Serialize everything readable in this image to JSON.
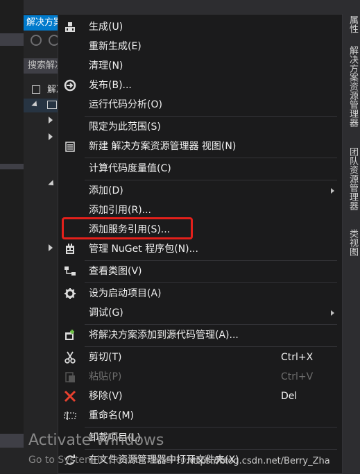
{
  "solution_explorer": {
    "title": "解决方案资源管理器",
    "search_placeholder": "搜索解决方案资源管理器",
    "root_label": "解决方案"
  },
  "right_tabs": [
    {
      "label": "属性"
    },
    {
      "label": "解决方案资源管理器"
    },
    {
      "label": "团队资源管理器"
    },
    {
      "label": "类视图"
    }
  ],
  "menu": {
    "items": [
      {
        "label": "生成(U)",
        "icon": "build-icon"
      },
      {
        "label": "重新生成(E)"
      },
      {
        "label": "清理(N)"
      },
      {
        "label": "发布(B)...",
        "icon": "publish-icon"
      },
      {
        "label": "运行代码分析(O)"
      },
      {
        "label": "限定为此范围(S)"
      },
      {
        "label": "新建 解决方案资源管理器 视图(N)",
        "icon": "new-view-icon"
      },
      {
        "label": "计算代码度量值(C)"
      },
      {
        "label": "添加(D)",
        "submenu": true
      },
      {
        "label": "添加引用(R)..."
      },
      {
        "label": "添加服务引用(S)..."
      },
      {
        "label": "管理 NuGet 程序包(N)...",
        "icon": "nuget-icon"
      },
      {
        "label": "查看类图(V)",
        "icon": "class-diagram-icon"
      },
      {
        "label": "设为启动项目(A)",
        "icon": "gear-icon"
      },
      {
        "label": "调试(G)",
        "submenu": true
      },
      {
        "label": "将解决方案添加到源代码管理(A)...",
        "icon": "source-control-icon"
      },
      {
        "label": "剪切(T)",
        "shortcut": "Ctrl+X",
        "icon": "scissors-icon"
      },
      {
        "label": "粘贴(P)",
        "shortcut": "Ctrl+V",
        "icon": "paste-icon",
        "disabled": true
      },
      {
        "label": "移除(V)",
        "shortcut": "Del",
        "icon": "remove-x-icon"
      },
      {
        "label": "重命名(M)",
        "icon": "rename-icon"
      },
      {
        "label": "卸载项目(L)"
      },
      {
        "label": "在文件资源管理器中打开文件夹(X)",
        "icon": "refresh-folder-icon"
      }
    ]
  },
  "watermark": {
    "line1": "Activate Windows",
    "line2": "Go to System in Control Panel to activate"
  },
  "credit": "https://blog.csdn.net/Berry_Zha",
  "colors": {
    "menu_bg": "#1b1b1c",
    "accent": "#007acc",
    "highlight": "#e3201b"
  }
}
